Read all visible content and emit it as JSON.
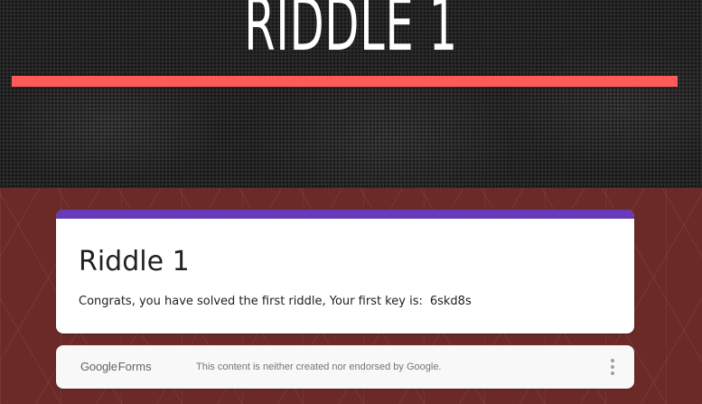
{
  "banner": {
    "title": "RIDDLE 1"
  },
  "form": {
    "title": "Riddle 1",
    "message": "Congrats, you have solved the first riddle, Your first key is:",
    "key": "6skd8s"
  },
  "footer": {
    "logo_google": "Google",
    "logo_forms": "Forms",
    "disclaimer": "This content is neither created nor endorsed by Google.",
    "more_icon": "more-vert-icon"
  },
  "colors": {
    "accent_red": "#ff5a5a",
    "form_accent_purple": "#673ab7",
    "background_maroon": "#6b2a27"
  }
}
